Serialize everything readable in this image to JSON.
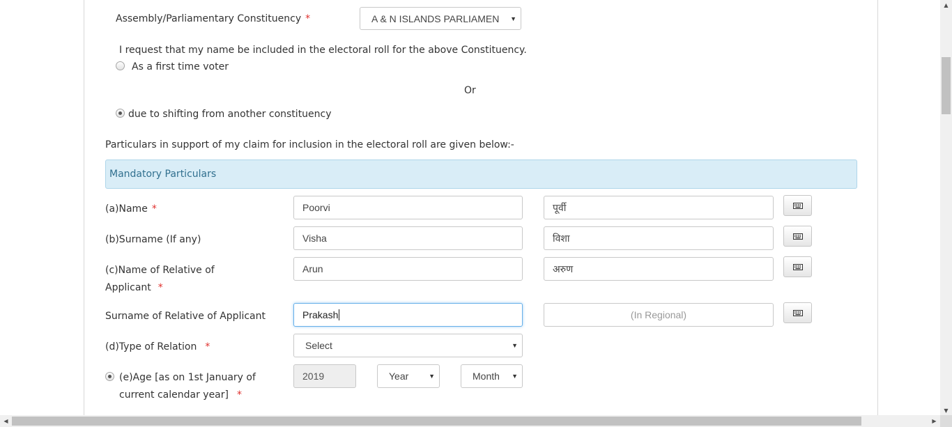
{
  "constituency": {
    "label": "Assembly/Parliamentary Constituency",
    "required": "*",
    "selected": "A & N ISLANDS PARLIAMEN"
  },
  "request_text": "I request that my name be included in the electoral roll for the above Constituency.",
  "options": {
    "first_time": "As a first time voter",
    "or": "Or",
    "shifting": "due to shifting from another constituency",
    "selected": "shifting"
  },
  "particulars_intro": "Particulars in support of my claim for inclusion in the electoral roll are given below:-",
  "panel": {
    "heading": "Mandatory Particulars"
  },
  "fields": {
    "name": {
      "label": "(a)Name",
      "required": "*",
      "value": "Poorvi",
      "regional": "पूर्वी"
    },
    "surname": {
      "label": "(b)Surname (If any)",
      "value": "Visha",
      "regional": "विशा"
    },
    "relative_name": {
      "label_line1": "(c)Name of Relative of",
      "label_line2": "Applicant",
      "required": "*",
      "value": "Arun",
      "regional": "अरुण"
    },
    "relative_surname": {
      "label": "Surname of Relative of Applicant",
      "value": "Prakash",
      "regional_placeholder": "(In Regional)"
    },
    "relation_type": {
      "label": "(d)Type of Relation",
      "required": "*",
      "selected": "Select"
    },
    "age": {
      "label_line1": "(e)Age [as on 1st January of",
      "label_line2": "current calendar year]",
      "required": "*",
      "calendar_year": "2019",
      "year": "Year",
      "month": "Month"
    }
  },
  "colors": {
    "required": "#e0312e",
    "panel_bg": "#d9edf7",
    "panel_text": "#31708f",
    "focus_border": "#66afe9"
  },
  "icons": {
    "keyboard": "keyboard-icon",
    "dropdown": "chevron-down-icon"
  }
}
